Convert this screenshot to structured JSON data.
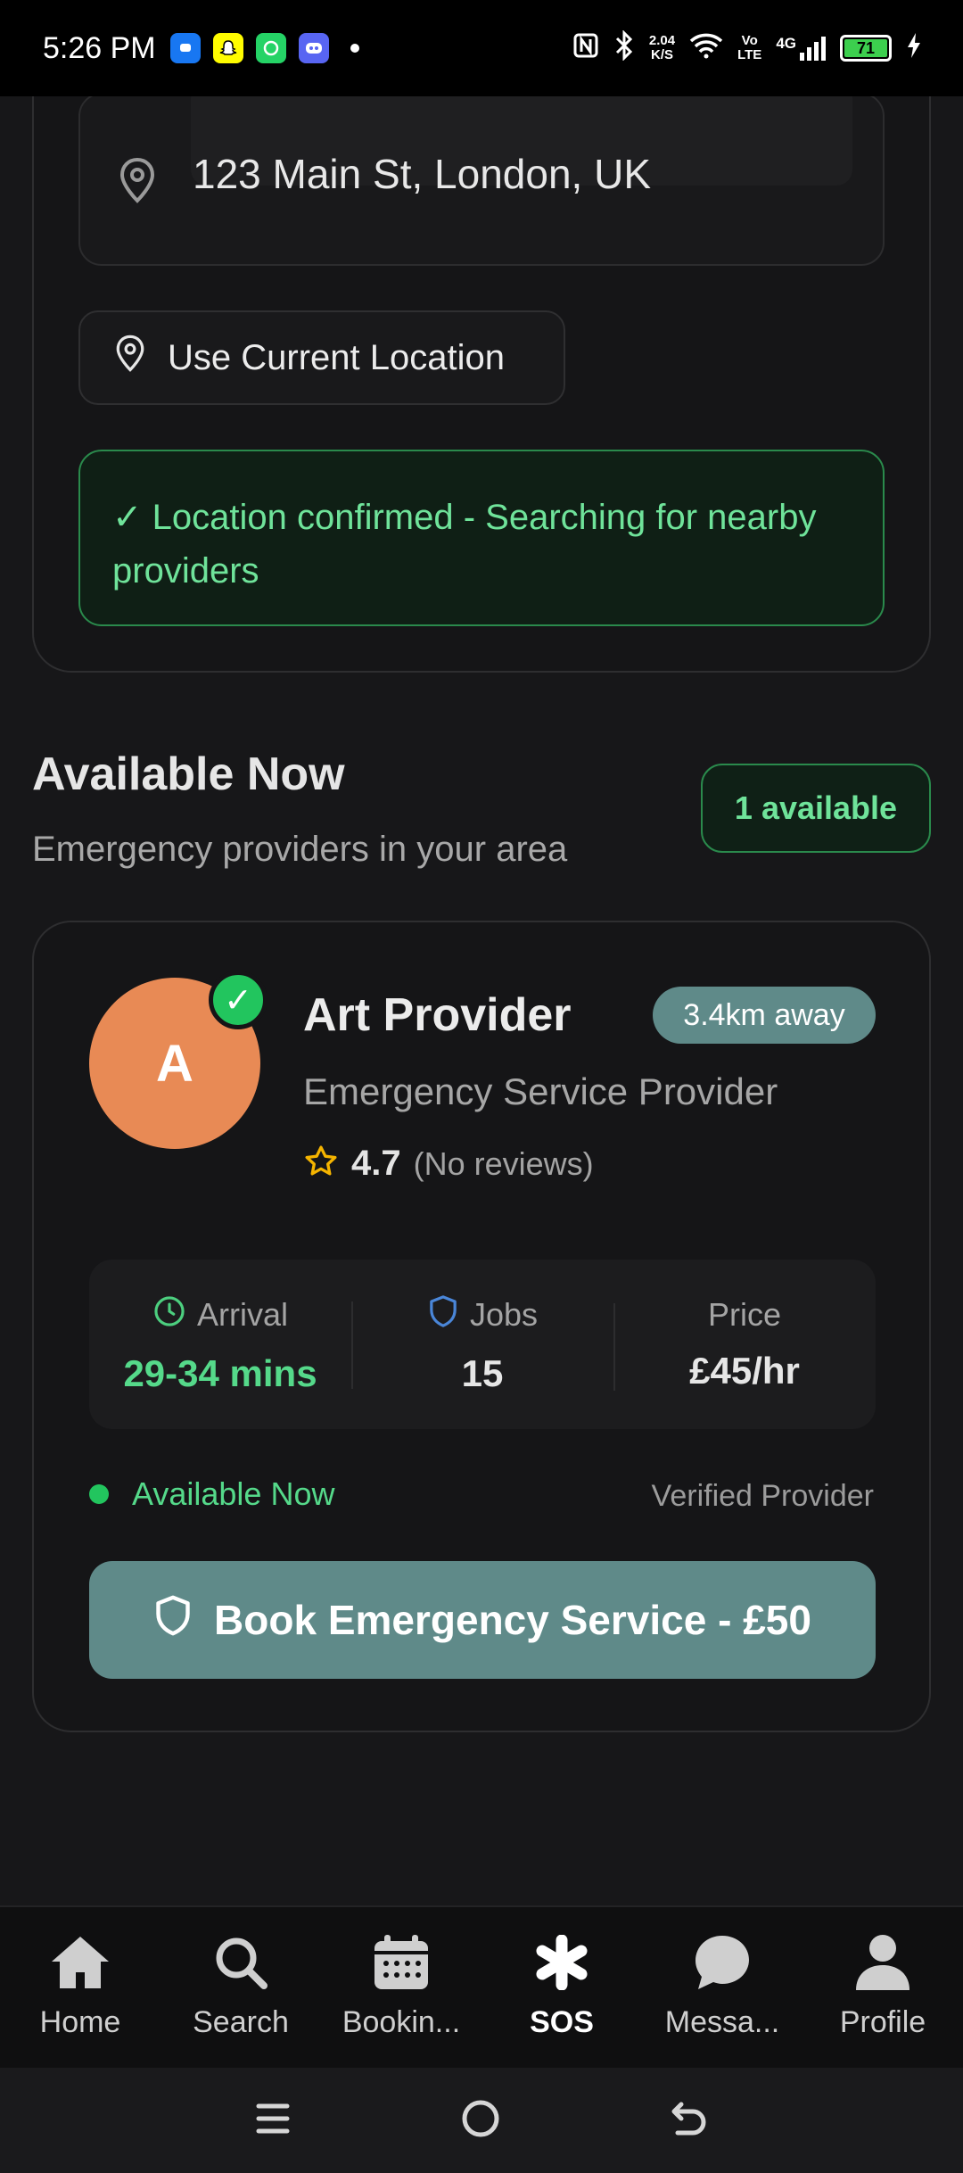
{
  "status_bar": {
    "time": "5:26 PM",
    "net_speed_top": "2.04",
    "net_speed_unit": "K/S",
    "volte_top": "Vo",
    "volte_bottom": "LTE",
    "network": "4G",
    "battery": "71",
    "notification_icons": [
      "messenger-icon",
      "snapchat-icon",
      "whatsapp-icon",
      "discord-icon"
    ]
  },
  "location": {
    "address_value": "123 Main St, London, UK",
    "use_current_label": "Use Current Location",
    "confirmation_text": "✓ Location confirmed - Searching for nearby providers"
  },
  "available": {
    "title": "Available Now",
    "subtitle": "Emergency providers in your area",
    "badge": "1 available"
  },
  "provider": {
    "initial": "A",
    "verified_mark": "✓",
    "name": "Art Provider",
    "distance": "3.4km away",
    "role": "Emergency Service Provider",
    "rating": "4.7",
    "reviews": "(No reviews)",
    "stats": {
      "arrival_label": "Arrival",
      "arrival_value": "29-34 mins",
      "jobs_label": "Jobs",
      "jobs_value": "15",
      "price_label": "Price",
      "price_value": "£45/hr"
    },
    "availability": "Available Now",
    "verified_label": "Verified Provider",
    "book_label": "Book Emergency Service - £50"
  },
  "nav": {
    "items": [
      {
        "label": "Home",
        "icon": "home-icon"
      },
      {
        "label": "Search",
        "icon": "search-icon"
      },
      {
        "label": "Bookin...",
        "icon": "calendar-icon"
      },
      {
        "label": "SOS",
        "icon": "asterisk-icon"
      },
      {
        "label": "Messa...",
        "icon": "chat-icon"
      },
      {
        "label": "Profile",
        "icon": "person-icon"
      }
    ],
    "active": "SOS"
  },
  "colors": {
    "accent": "#5f8a89",
    "success": "#22c55e",
    "success_text": "#6fe39a",
    "avatar": "#e88a55",
    "star": "#f5b400"
  }
}
